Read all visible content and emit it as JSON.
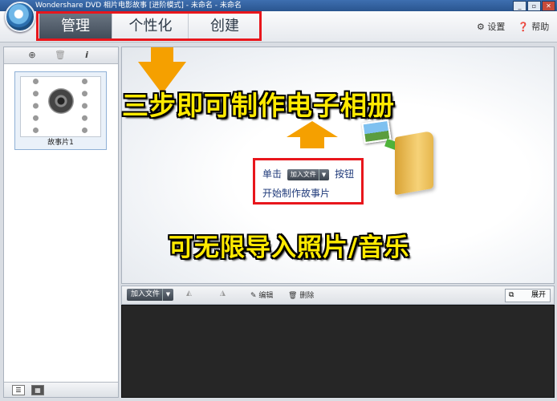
{
  "window": {
    "title": "Wondershare DVD 相片电影故事 [进阶模式] - 未命名 - 未命名",
    "controls": [
      "_",
      "▫",
      "✕"
    ]
  },
  "header": {
    "tabs": [
      {
        "label": "管理",
        "active": true
      },
      {
        "label": "个性化",
        "active": false
      },
      {
        "label": "创建",
        "active": false
      }
    ],
    "settings": "设置",
    "help": "帮助",
    "settings_icon": "gear-icon",
    "help_icon": "question-icon"
  },
  "left_panel": {
    "toolbar_icons": [
      "add-story-icon",
      "trash-icon",
      "info-icon"
    ],
    "story_label": "故事片1"
  },
  "stage": {
    "headline_top": "三步即可制作电子相册",
    "instruction": {
      "prefix": "单击",
      "button_label": "加入文件",
      "suffix": "按钮",
      "line2": "开始制作故事片"
    },
    "headline_bottom": "可无限导入照片/音乐"
  },
  "timeline_toolbar": {
    "add_file": "加入文件",
    "edit": "编辑",
    "delete": "删除",
    "expand": "展开"
  },
  "colors": {
    "highlight_red": "#e8161c",
    "headline_yellow": "#ffea00",
    "arrow_orange": "#f5a000",
    "timeline_bg": "#262626"
  }
}
